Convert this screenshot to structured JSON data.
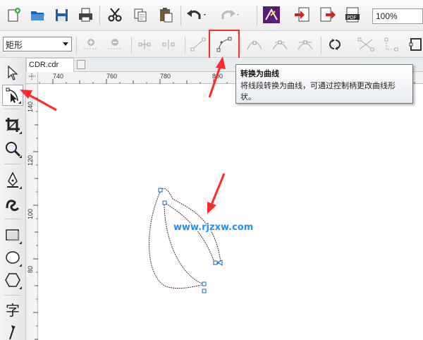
{
  "toolbar": {
    "zoom_value": "100%"
  },
  "property_bar": {
    "shape_type": "矩形"
  },
  "document": {
    "tab_name": "CDR.cdr"
  },
  "rulers": {
    "horizontal": [
      "740",
      "760",
      "780",
      "800"
    ],
    "vertical": [
      "140",
      "120",
      "100",
      "80"
    ]
  },
  "tooltip": {
    "title": "转换为曲线",
    "body": "将线段转换为曲线，可通过控制柄更改曲线形状。"
  },
  "watermark": "www.rjzxw.com",
  "annotation_color": "#ff2a2a"
}
